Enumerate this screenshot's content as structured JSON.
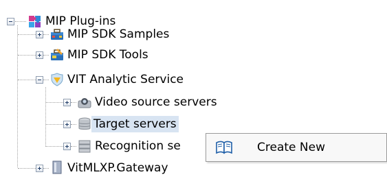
{
  "tree": {
    "root": {
      "label": "MIP Plug-ins",
      "icon": "puzzle-pieces-icon"
    },
    "items": [
      {
        "label": "MIP SDK Samples",
        "icon": "toolbox-samples-icon"
      },
      {
        "label": "MIP SDK Tools",
        "icon": "toolbox-tools-icon"
      },
      {
        "label": "VIT Analytic Service",
        "icon": "shield-analytic-icon"
      },
      {
        "label": "Video source servers",
        "icon": "camera-server-icon"
      },
      {
        "label": "Target servers",
        "icon": "database-icon",
        "selected": true
      },
      {
        "label": "Recognition se",
        "icon": "server-stack-icon"
      },
      {
        "label": "VitMLXP.Gateway",
        "icon": "gateway-box-icon"
      }
    ]
  },
  "context_menu": {
    "items": [
      {
        "label": "Create New",
        "icon": "open-book-icon"
      }
    ]
  },
  "colors": {
    "selection": "#d8e4f2",
    "menu_bg": "#f8f8f8",
    "tree_lines": "#a0a0a0"
  }
}
